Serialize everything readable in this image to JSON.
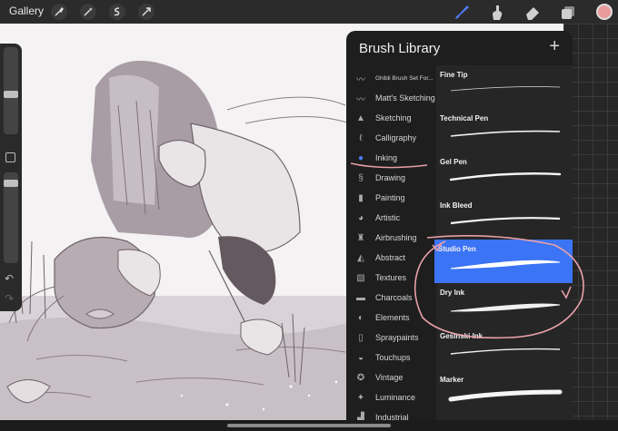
{
  "topbar": {
    "gallery_label": "Gallery",
    "left_tools": [
      "wrench-icon",
      "magic-wand-icon",
      "selection-icon",
      "transform-icon"
    ],
    "right_tools": [
      "brush-icon",
      "smudge-icon",
      "eraser-icon",
      "layers-icon"
    ],
    "color_swatch": "#e89a9a",
    "accent": "#4d7cf7"
  },
  "library": {
    "title": "Brush Library",
    "plus_label": "+",
    "categories": [
      {
        "label": "Ghibli Brush Set For...",
        "icon": "brush-stroke-icon"
      },
      {
        "label": "Matt's Sketching",
        "icon": "brush-stroke-icon"
      },
      {
        "label": "Sketching",
        "icon": "pencil-tip-icon"
      },
      {
        "label": "Calligraphy",
        "icon": "calligraphy-icon"
      },
      {
        "label": "Inking",
        "icon": "ink-drop-icon"
      },
      {
        "label": "Drawing",
        "icon": "swirl-icon"
      },
      {
        "label": "Painting",
        "icon": "paint-brush-icon"
      },
      {
        "label": "Artistic",
        "icon": "palette-icon"
      },
      {
        "label": "Airbrushing",
        "icon": "airbrush-icon"
      },
      {
        "label": "Abstract",
        "icon": "triangle-icon"
      },
      {
        "label": "Textures",
        "icon": "texture-icon"
      },
      {
        "label": "Charcoals",
        "icon": "charcoal-icon"
      },
      {
        "label": "Elements",
        "icon": "yin-yang-icon"
      },
      {
        "label": "Spraypaints",
        "icon": "spray-can-icon"
      },
      {
        "label": "Touchups",
        "icon": "touchup-icon"
      },
      {
        "label": "Vintage",
        "icon": "star-badge-icon"
      },
      {
        "label": "Luminance",
        "icon": "sparkle-icon"
      },
      {
        "label": "Industrial",
        "icon": "anvil-icon"
      }
    ],
    "active_category": "Inking",
    "brushes": [
      {
        "name": "Fine Tip"
      },
      {
        "name": "Technical Pen"
      },
      {
        "name": "Gel Pen"
      },
      {
        "name": "Ink Bleed"
      },
      {
        "name": "Studio Pen"
      },
      {
        "name": "Dry Ink"
      },
      {
        "name": "Gesinski Ink"
      },
      {
        "name": "Marker"
      }
    ],
    "selected_brush": "Studio Pen"
  }
}
